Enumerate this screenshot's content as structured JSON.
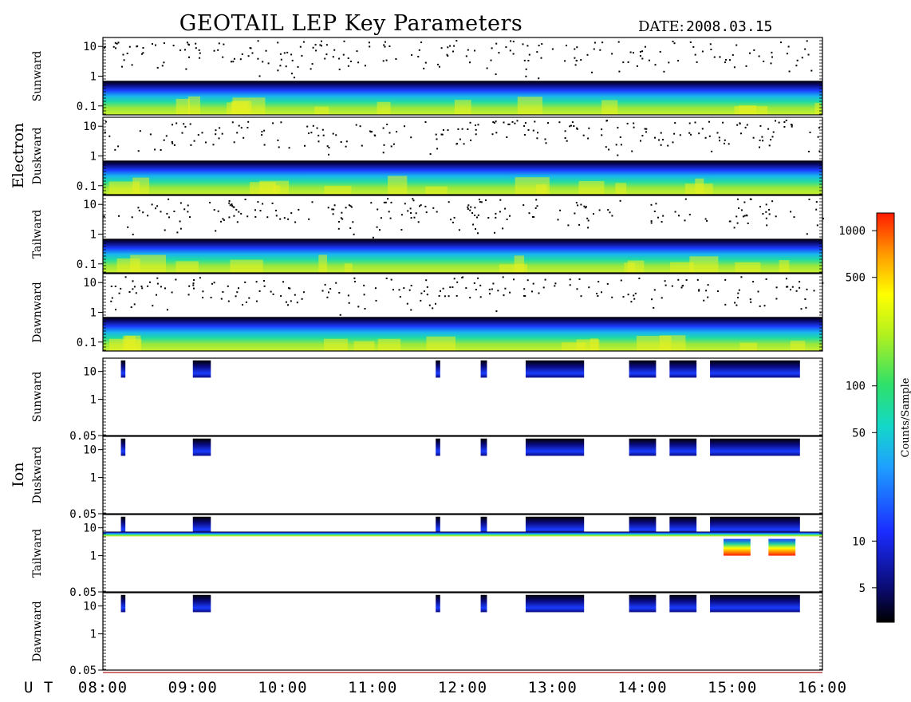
{
  "header": {
    "title": "GEOTAIL LEP Key Parameters",
    "date_label": "DATE:",
    "date_value": "2008.03.15"
  },
  "time_axis": {
    "prefix": "U T",
    "ticks": [
      "08:00",
      "09:00",
      "10:00",
      "11:00",
      "12:00",
      "13:00",
      "14:00",
      "15:00",
      "16:00"
    ]
  },
  "groups": [
    {
      "label": "Electron",
      "panels": [
        "Sunward",
        "Duskward",
        "Tailward",
        "Dawnward"
      ]
    },
    {
      "label": "Ion",
      "panels": [
        "Sunward",
        "Duskward",
        "Tailward",
        "Dawnward"
      ]
    }
  ],
  "colorbar": {
    "label": "Counts/Sample",
    "ticks": [
      "1000",
      "500",
      "100",
      "50",
      "10",
      "5"
    ],
    "scale": "log"
  },
  "chart_data": {
    "type": "heatmap",
    "title": "GEOTAIL LEP Key Parameters",
    "x": {
      "unit": "UT",
      "range": [
        "08:00",
        "16:00"
      ],
      "ticks": [
        "08:00",
        "09:00",
        "10:00",
        "11:00",
        "12:00",
        "13:00",
        "14:00",
        "15:00",
        "16:00"
      ]
    },
    "panels": [
      {
        "group": "Electron",
        "name": "Sunward",
        "y_scale": "log",
        "y_ticks": [
          "10",
          "1",
          "0.1"
        ],
        "y_range": [
          0.05,
          20
        ]
      },
      {
        "group": "Electron",
        "name": "Duskward",
        "y_scale": "log",
        "y_ticks": [
          "10",
          "1",
          "0.1"
        ],
        "y_range": [
          0.05,
          20
        ]
      },
      {
        "group": "Electron",
        "name": "Tailward",
        "y_scale": "log",
        "y_ticks": [
          "10",
          "1",
          "0.1"
        ],
        "y_range": [
          0.05,
          20
        ]
      },
      {
        "group": "Electron",
        "name": "Dawnward",
        "y_scale": "log",
        "y_ticks": [
          "10",
          "1",
          "0.1"
        ],
        "y_range": [
          0.05,
          20
        ]
      },
      {
        "group": "Ion",
        "name": "Sunward",
        "y_scale": "log",
        "y_ticks": [
          "10",
          "1",
          "0.05"
        ],
        "y_range": [
          0.05,
          30
        ]
      },
      {
        "group": "Ion",
        "name": "Duskward",
        "y_scale": "log",
        "y_ticks": [
          "10",
          "1",
          "0.05"
        ],
        "y_range": [
          0.05,
          30
        ]
      },
      {
        "group": "Ion",
        "name": "Tailward",
        "y_scale": "log",
        "y_ticks": [
          "10",
          "1",
          "0.05"
        ],
        "y_range": [
          0.05,
          30
        ]
      },
      {
        "group": "Ion",
        "name": "Dawnward",
        "y_scale": "log",
        "y_ticks": [
          "10",
          "1",
          "0.05"
        ],
        "y_range": [
          0.05,
          30
        ]
      }
    ],
    "colorbar": {
      "label": "Counts/Sample",
      "scale": "log",
      "range": [
        3,
        1300
      ],
      "ticks": [
        1000,
        500,
        100,
        50,
        10,
        5
      ]
    }
  }
}
